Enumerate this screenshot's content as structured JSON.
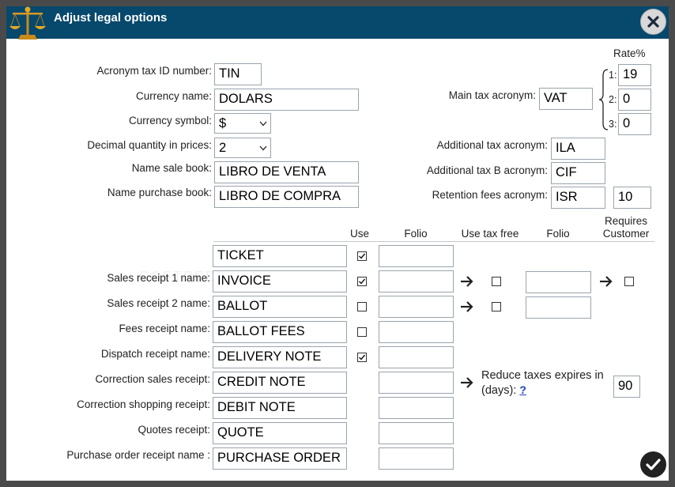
{
  "window": {
    "title": "Adjust legal options"
  },
  "icons": {
    "app": "scales-of-justice-icon",
    "close": "close-icon",
    "confirm": "check-icon",
    "arrow": "arrow-right-icon"
  },
  "colors": {
    "titlebar": "#07486d",
    "help_link": "#1a3fbf"
  },
  "general": {
    "acronym_tax_id": {
      "label": "Acronym tax ID number:",
      "value": "TIN"
    },
    "currency_name": {
      "label": "Currency name:",
      "value": "DOLARS"
    },
    "currency_symbol": {
      "label": "Currency symbol:",
      "value": "$"
    },
    "decimal_quantity": {
      "label": "Decimal quantity in prices:",
      "value": "2"
    },
    "name_sale_book": {
      "label": "Name sale book:",
      "value": "LIBRO DE VENTA"
    },
    "name_purchase_book": {
      "label": "Name purchase book:",
      "value": "LIBRO DE COMPRA"
    }
  },
  "tax": {
    "rate_header": "Rate%",
    "main_tax_acronym": {
      "label": "Main tax acronym:",
      "value": "VAT"
    },
    "rates": [
      {
        "index": "1:",
        "value": "19"
      },
      {
        "index": "2:",
        "value": "0"
      },
      {
        "index": "3:",
        "value": "0"
      }
    ],
    "additional_tax_acronym": {
      "label": "Additional tax acronym:",
      "value": "ILA"
    },
    "additional_tax_b_acronym": {
      "label": "Additional tax B acronym:",
      "value": "CIF"
    },
    "retention_fees_acronym": {
      "label": "Retention fees acronym:",
      "value": "ISR",
      "rate": "10"
    }
  },
  "receipts": {
    "headers": {
      "use": "Use",
      "folio": "Folio",
      "use_tax_free": "Use tax free",
      "folio2": "Folio",
      "requires_customer": "Requires Customer"
    },
    "rows": [
      {
        "label": "",
        "value": "TICKET",
        "use": true
      },
      {
        "label": "Sales receipt 1 name:",
        "value": "INVOICE",
        "use": true
      },
      {
        "label": "Sales receipt 2 name:",
        "value": "BALLOT",
        "use": false
      },
      {
        "label": "Fees receipt name:",
        "value": "BALLOT FEES",
        "use": false
      },
      {
        "label": "Dispatch receipt name:",
        "value": "DELIVERY NOTE",
        "use": true
      },
      {
        "label": "Correction sales receipt:",
        "value": "CREDIT NOTE"
      },
      {
        "label": "Correction shopping receipt:",
        "value": "DEBIT NOTE"
      },
      {
        "label": "Quotes receipt:",
        "value": "QUOTE"
      },
      {
        "label": "Purchase order receipt name :",
        "value": "PURCHASE ORDER"
      }
    ],
    "tax_free": [
      {
        "checked": false
      },
      {
        "checked": false
      }
    ],
    "requires_customer": [
      {
        "checked": false
      }
    ]
  },
  "reduce_taxes": {
    "label": "Reduce taxes expires in (days):",
    "help": "?",
    "value": "90"
  }
}
